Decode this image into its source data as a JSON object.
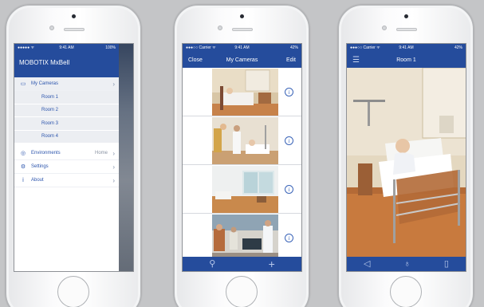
{
  "status": {
    "carrier": "●●●●● ᯤ",
    "carrier_named": "●●●○○ Carrier ᯤ",
    "time": "9:41 AM",
    "battery": "100%",
    "battery_partial": "42%"
  },
  "phone1": {
    "app_title": "MOBOTIX MxBell",
    "menu": {
      "my_cameras": "My Cameras",
      "rooms": [
        "Room 1",
        "Room 2",
        "Room 3",
        "Room 4"
      ],
      "environments": "Environments",
      "environments_value": "Home",
      "settings": "Settings",
      "about": "About"
    },
    "shade_battery": "100%"
  },
  "phone2": {
    "nav_left": "Close",
    "nav_title": "My Cameras",
    "nav_right": "Edit",
    "info_glyph": "i"
  },
  "phone3": {
    "nav_title": "Room 1"
  },
  "icons": {
    "menu": "hamburger-icon",
    "search": "search-icon",
    "add": "plus-icon",
    "speaker": "speaker-icon",
    "mic": "microphone-icon",
    "door": "door-icon"
  }
}
